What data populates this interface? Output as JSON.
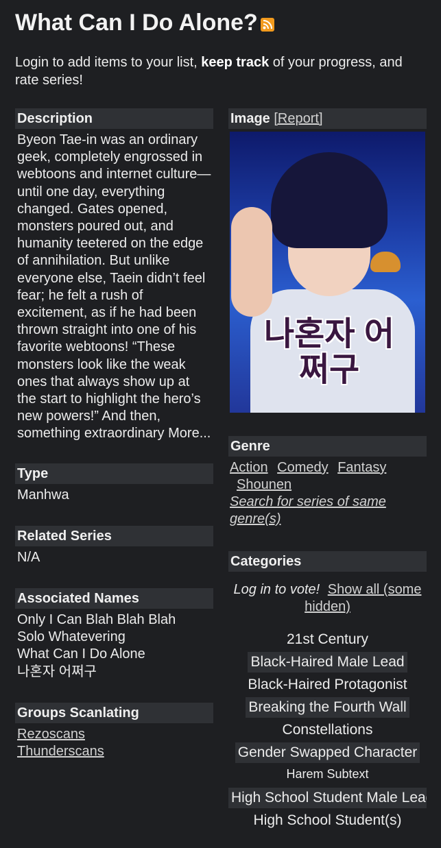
{
  "title": "What Can I Do Alone?",
  "rss_icon": "rss-icon",
  "intro": {
    "prefix": "Login to add items to your list, ",
    "bold": "keep track",
    "suffix": " of your progress, and rate series!"
  },
  "description": {
    "heading": "Description",
    "text": "Byeon Tae-in was an ordinary geek, completely engrossed in webtoons and internet culture—until one day, everything changed. Gates opened, monsters poured out, and humanity teetered on the edge of annihilation. But unlike everyone else, Taein didn’t feel fear; he felt a rush of excitement, as if he had been thrown straight into one of his favorite webtoons! “These monsters look like the weak ones that always show up at the start to highlight the hero’s new powers!” And then, something extraordinary",
    "more": "More..."
  },
  "type": {
    "heading": "Type",
    "value": "Manhwa"
  },
  "related": {
    "heading": "Related Series",
    "value": "N/A"
  },
  "associated": {
    "heading": "Associated Names",
    "names": [
      "Only I Can Blah Blah Blah",
      "Solo Whatevering",
      "What Can I Do Alone",
      "나혼자 어쩌구"
    ]
  },
  "groups": {
    "heading": "Groups Scanlating",
    "items": [
      "Rezoscans",
      "Thunderscans"
    ]
  },
  "image": {
    "heading": "Image",
    "report": "[Report]",
    "cover_text": "나혼자 어쩌구"
  },
  "genre": {
    "heading": "Genre",
    "items": [
      "Action",
      "Comedy",
      "Fantasy",
      "Shounen"
    ],
    "search": "Search for series of same genre(s)"
  },
  "categories": {
    "heading": "Categories",
    "login": "Log in to vote!",
    "show_all": "Show all (some hidden)",
    "items": [
      "21st Century",
      "Black-Haired Male Lead",
      "Black-Haired Protagonist",
      "Breaking the Fourth Wall",
      "Constellations",
      "Gender Swapped Character",
      "Harem Subtext",
      "High School Student Male Lead",
      "High School Student(s)"
    ]
  }
}
